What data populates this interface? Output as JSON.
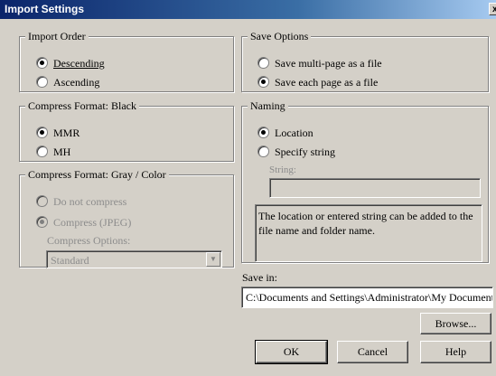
{
  "window": {
    "title": "Import Settings",
    "close_glyph": "x"
  },
  "import_order": {
    "legend": "Import Order",
    "options": [
      {
        "label": "Descending",
        "selected": true
      },
      {
        "label": "Ascending",
        "selected": false
      }
    ]
  },
  "compress_black": {
    "legend": "Compress Format: Black",
    "options": [
      {
        "label": "MMR",
        "selected": true
      },
      {
        "label": "MH",
        "selected": false
      }
    ]
  },
  "compress_gray": {
    "legend": "Compress Format: Gray / Color",
    "enabled": false,
    "options": [
      {
        "label": "Do not compress",
        "selected": false
      },
      {
        "label": "Compress (JPEG)",
        "selected": true
      }
    ],
    "compress_options_label": "Compress Options:",
    "compress_options_value": "Standard"
  },
  "save_options": {
    "legend": "Save Options",
    "options": [
      {
        "label": "Save multi-page as a file",
        "selected": false
      },
      {
        "label": "Save each page as a file",
        "selected": true
      }
    ]
  },
  "naming": {
    "legend": "Naming",
    "options": [
      {
        "label": "Location",
        "selected": true
      },
      {
        "label": "Specify string",
        "selected": false
      }
    ],
    "string_label": "String:",
    "string_value": "",
    "note": "The location or entered string can be added to the file name and folder name."
  },
  "save_in": {
    "label": "Save in:",
    "value": "C:\\Documents and Settings\\Administrator\\My Documents"
  },
  "buttons": {
    "browse": "Browse...",
    "ok": "OK",
    "cancel": "Cancel",
    "help": "Help"
  }
}
